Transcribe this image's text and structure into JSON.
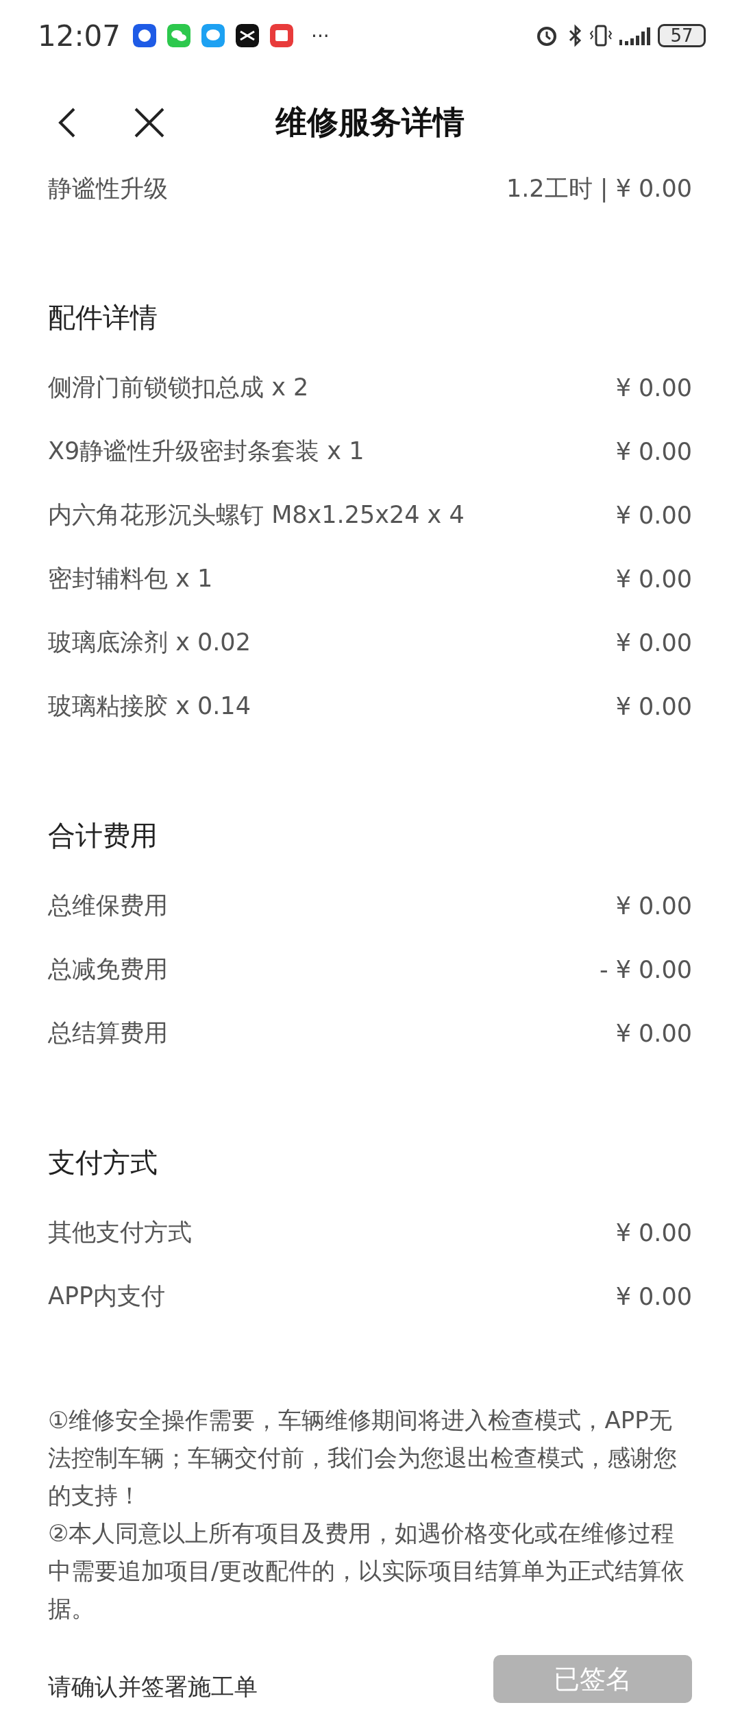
{
  "status_bar": {
    "time": "12:07",
    "more": "···",
    "battery": "57"
  },
  "header": {
    "title": "维修服务详情"
  },
  "labor_items": [
    {
      "name": "静谧性升级",
      "value": "1.2工时 | ¥ 0.00"
    }
  ],
  "sections": [
    {
      "title": "配件详情",
      "rows": [
        {
          "label": "侧滑门前锁锁扣总成 x 2",
          "value": "¥ 0.00"
        },
        {
          "label": "X9静谧性升级密封条套装 x 1",
          "value": "¥ 0.00"
        },
        {
          "label": "内六角花形沉头螺钉 M8x1.25x24 x 4",
          "value": "¥ 0.00"
        },
        {
          "label": "密封辅料包 x 1",
          "value": "¥ 0.00"
        },
        {
          "label": "玻璃底涂剂 x 0.02",
          "value": "¥ 0.00"
        },
        {
          "label": "玻璃粘接胶 x 0.14",
          "value": "¥ 0.00"
        }
      ]
    },
    {
      "title": "合计费用",
      "rows": [
        {
          "label": "总维保费用",
          "value": "¥ 0.00"
        },
        {
          "label": "总减免费用",
          "value": "- ¥ 0.00"
        },
        {
          "label": "总结算费用",
          "value": "¥ 0.00"
        }
      ]
    },
    {
      "title": "支付方式",
      "rows": [
        {
          "label": "其他支付方式",
          "value": "¥ 0.00"
        },
        {
          "label": "APP内支付",
          "value": "¥ 0.00"
        }
      ]
    }
  ],
  "notes": [
    "①维修安全操作需要，车辆维修期间将进入检查模式，APP无法控制车辆；车辆交付前，我们会为您退出检查模式，感谢您的支持！",
    "②本人同意以上所有项目及费用，如遇价格变化或在维修过程中需要追加项目/更改配件的，以实际项目结算单为正式结算依据。"
  ],
  "footer": {
    "prompt": "请确认并签署施工单",
    "button": {
      "label": "已签名",
      "disabled": true
    }
  }
}
